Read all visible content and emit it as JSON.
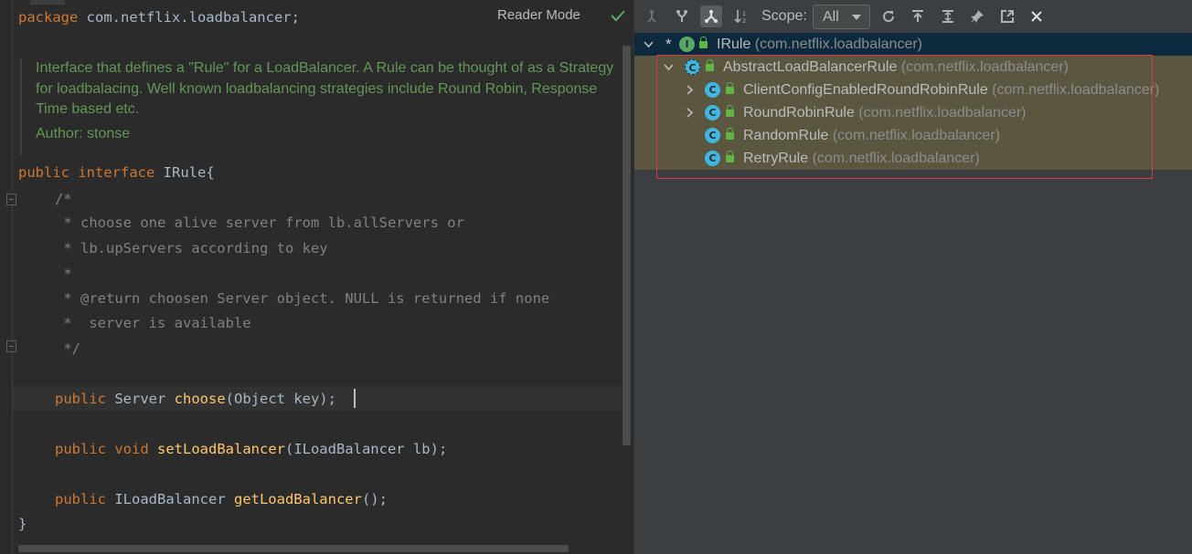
{
  "editor": {
    "reader_mode_label": "Reader Mode",
    "lines": {
      "package_kw": "package",
      "package_name": " com.netflix.loadbalancer;",
      "public_kw": "public",
      "interface_kw": "interface",
      "interface_name": " IRule{",
      "comment_open": "/*",
      "comment_1": " * choose one alive server from lb.allServers or",
      "comment_2": " * lb.upServers according to key",
      "comment_3": " *",
      "comment_4": " * @return choosen Server object. NULL is returned if none",
      "comment_5": " *  server is available",
      "comment_close": " */",
      "m1_public": "public",
      "m1_type": " Server ",
      "m1_name": "choose",
      "m1_params": "(Object key);",
      "m2_public": "public",
      "m2_type": " void ",
      "m2_name": "setLoadBalancer",
      "m2_params": "(ILoadBalancer lb);",
      "m3_public": "public",
      "m3_type": " ILoadBalancer ",
      "m3_name": "getLoadBalancer",
      "m3_params": "();",
      "close_brace": "}"
    },
    "doc": {
      "text": "Interface that defines a \"Rule\" for a LoadBalancer. A Rule can be thought of as a Strategy for loadbalacing. Well known loadbalancing strategies include Round Robin, Response Time based etc.",
      "author": "Author: stonse"
    }
  },
  "hierarchy": {
    "scope_label": "Scope:",
    "scope_value": "All",
    "toolbar_icons": [
      "supertypes-hierarchy-icon",
      "subtypes-hierarchy-icon",
      "class-hierarchy-icon",
      "sort-alphabetically-icon",
      "refresh-icon",
      "export-icon",
      "expand-all-icon",
      "pin-icon",
      "open-in-new-window-icon",
      "close-icon"
    ],
    "tree": [
      {
        "name": "IRule",
        "pkg": " (com.netflix.loadbalancer)",
        "kind": "interface",
        "icon_letter": "I",
        "star": "*"
      },
      {
        "name": "AbstractLoadBalancerRule",
        "pkg": " (com.netflix.loadbalancer)",
        "kind": "abstract-class",
        "icon_letter": "C"
      },
      {
        "name": "ClientConfigEnabledRoundRobinRule",
        "pkg": " (com.netflix.loadbalancer)",
        "kind": "class",
        "icon_letter": "C"
      },
      {
        "name": "RoundRobinRule",
        "pkg": " (com.netflix.loadbalancer)",
        "kind": "class",
        "icon_letter": "C"
      },
      {
        "name": "RandomRule",
        "pkg": " (com.netflix.loadbalancer)",
        "kind": "class",
        "icon_letter": "C"
      },
      {
        "name": "RetryRule",
        "pkg": " (com.netflix.loadbalancer)",
        "kind": "class",
        "icon_letter": "C"
      }
    ],
    "colors": {
      "selection": "#0d293e",
      "highlight": "#5b5640",
      "annotation_box": "#e0364a",
      "interface_icon": "#59a869",
      "class_icon": "#40b6e0"
    }
  }
}
